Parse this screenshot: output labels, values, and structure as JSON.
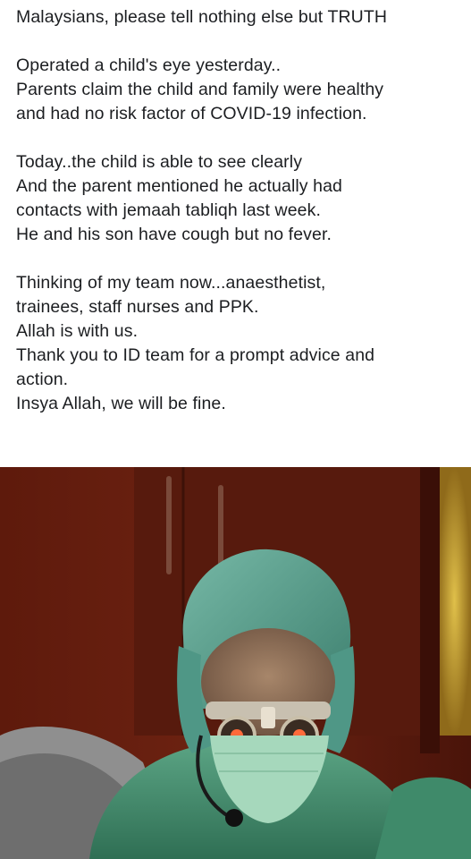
{
  "post": {
    "paragraphs": [
      [
        "Malaysians, please tell nothing else but TRUTH"
      ],
      [
        "Operated a child's eye yesterday..",
        "Parents claim the child and family were healthy",
        "and had no risk factor of COVID-19 infection."
      ],
      [
        "Today..the child is able to see clearly",
        "And the parent mentioned he actually had",
        "contacts with jemaah tabliqh last week.",
        "He and his son have cough but no fever."
      ],
      [
        "Thinking of my team now...anaesthetist,",
        "trainees, staff nurses and PPK.",
        "Allah is with us.",
        "Thank you to ID team for a prompt advice and",
        "action.",
        "Insya Allah, we will be fine."
      ]
    ]
  },
  "photo": {
    "subject": "surgeon-in-scrubs-with-loupes",
    "colors": {
      "wall": "#6a1f10",
      "door": "#5a1a0e",
      "cap": "#4e9a86",
      "gown": "#3f8a6a",
      "mask": "#9fd2b4",
      "light_spot": "#c49a2a"
    }
  }
}
